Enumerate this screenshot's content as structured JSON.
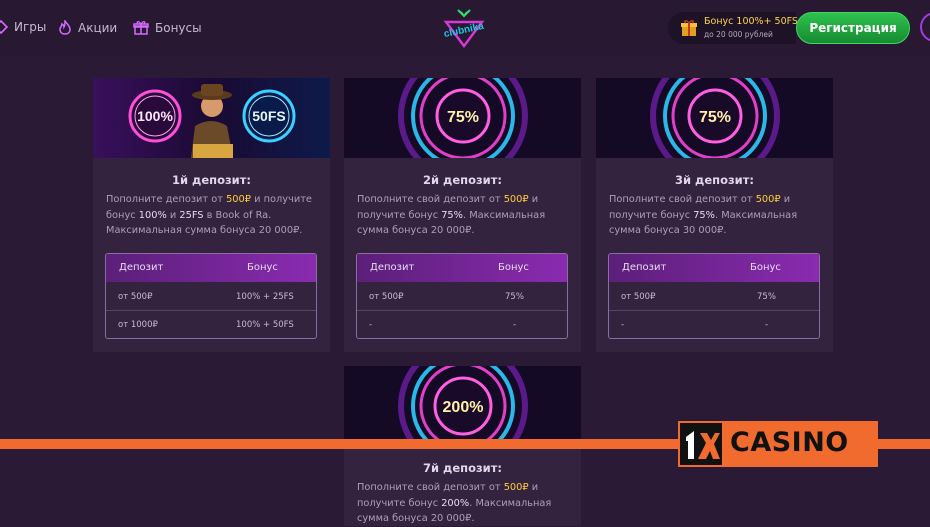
{
  "nav": {
    "items": [
      {
        "label": "Игры",
        "icon": "games-icon"
      },
      {
        "label": "Акции",
        "icon": "flame-icon"
      },
      {
        "label": "Бонусы",
        "icon": "gift-icon"
      }
    ],
    "logo_text": "clubnika"
  },
  "header": {
    "bonus_title": "Бонус 100%+ 50FS",
    "bonus_subtitle": "до 20 000 рублей",
    "register_label": "Регистрация"
  },
  "table_headers": {
    "deposit": "Депозит",
    "bonus": "Бонус"
  },
  "cards": [
    {
      "badge_left": "100%",
      "badge_right": "50FS",
      "title": "1й депозит:",
      "desc": [
        {
          "t": "Пополните депозит от ",
          "s": "n"
        },
        {
          "t": "500₽",
          "s": "hl"
        },
        {
          "t": " и получите бонус ",
          "s": "n"
        },
        {
          "t": "100%",
          "s": "w"
        },
        {
          "t": " и ",
          "s": "n"
        },
        {
          "t": "25FS",
          "s": "w"
        },
        {
          "t": " в Book of Ra.",
          "s": "n"
        },
        {
          "t": " Максимальная сумма бонуса 20 000₽.",
          "s": "n"
        }
      ],
      "rows": [
        {
          "deposit": "от 500₽",
          "bonus": "100% + 25FS"
        },
        {
          "deposit": "от 1000₽",
          "bonus": "100% + 50FS"
        }
      ]
    },
    {
      "badge": "75%",
      "title": "2й депозит:",
      "desc": [
        {
          "t": "Пополните свой депозит от ",
          "s": "n"
        },
        {
          "t": "500₽",
          "s": "hl"
        },
        {
          "t": " и получите бонус ",
          "s": "n"
        },
        {
          "t": "75%",
          "s": "w"
        },
        {
          "t": ".",
          "s": "n"
        },
        {
          "t": " Максимальная сумма бонуса 20 000₽.",
          "s": "n"
        }
      ],
      "rows": [
        {
          "deposit": "от 500₽",
          "bonus": "75%"
        },
        {
          "deposit": "-",
          "bonus": "-"
        }
      ]
    },
    {
      "badge": "75%",
      "title": "3й депозит:",
      "desc": [
        {
          "t": "Пополните свой депозит от ",
          "s": "n"
        },
        {
          "t": "500₽",
          "s": "hl"
        },
        {
          "t": " и получите бонус ",
          "s": "n"
        },
        {
          "t": "75%",
          "s": "w"
        },
        {
          "t": ".",
          "s": "n"
        },
        {
          "t": " Максимальная сумма бонуса 30 000₽.",
          "s": "n"
        }
      ],
      "rows": [
        {
          "deposit": "от 500₽",
          "bonus": "75%"
        },
        {
          "deposit": "-",
          "bonus": "-"
        }
      ]
    },
    {
      "badge": "200%",
      "title": "7й депозит:",
      "desc": [
        {
          "t": "Пополните свой депозит от ",
          "s": "n"
        },
        {
          "t": "500₽",
          "s": "hl"
        },
        {
          "t": " и получите бонус ",
          "s": "n"
        },
        {
          "t": "200%",
          "s": "w"
        },
        {
          "t": ". Максимальная сумма бонуса 20 000₽.",
          "s": "n"
        }
      ]
    }
  ],
  "watermark": {
    "text": "CASINO",
    "logo": "1x"
  },
  "colors": {
    "accent": "#9b2fd0",
    "cta": "#22a83f",
    "highlight": "#ffcf3a",
    "watermark": "#f06b2d"
  }
}
